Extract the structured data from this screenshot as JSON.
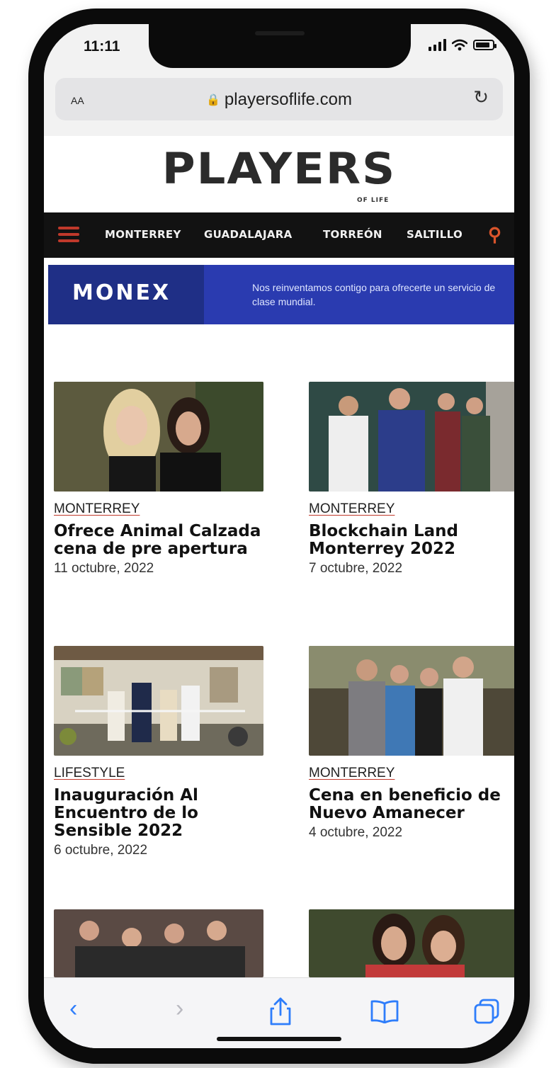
{
  "status": {
    "time": "11:11",
    "battery_level": 0.85
  },
  "browser": {
    "text_size_label": "AA",
    "url": "playersoflife.com",
    "reload_glyph": "↻"
  },
  "site": {
    "logo": "PLAYERS",
    "logo_sub": "OF LIFE",
    "nav": [
      "MONTERREY",
      "GUADALAJARA",
      "TORREÓN",
      "SALTILLO"
    ]
  },
  "banner": {
    "brand": "MONEX",
    "text": "Nos reinventamos contigo para ofrecerte un servicio de clase mundial."
  },
  "posts": [
    {
      "category": "MONTERREY",
      "title": "Ofrece Animal Calzada cena de pre apertura",
      "date": "11 octubre, 2022"
    },
    {
      "category": "MONTERREY",
      "title": "Blockchain Land Monterrey 2022",
      "date": "7 octubre, 2022"
    },
    {
      "category": "LIFESTYLE",
      "title": "Inauguración Al Encuentro de lo Sensible 2022",
      "date": "6 octubre, 2022"
    },
    {
      "category": "MONTERREY",
      "title": "Cena en beneficio de Nuevo Amanecer",
      "date": "4 octubre, 2022"
    }
  ],
  "toolbar": {
    "back": "‹",
    "forward": "›"
  },
  "colors": {
    "nav_bg": "#121212",
    "accent": "#c0392b",
    "banner": "#2a3bb0",
    "link_blue": "#2e7dfb"
  }
}
